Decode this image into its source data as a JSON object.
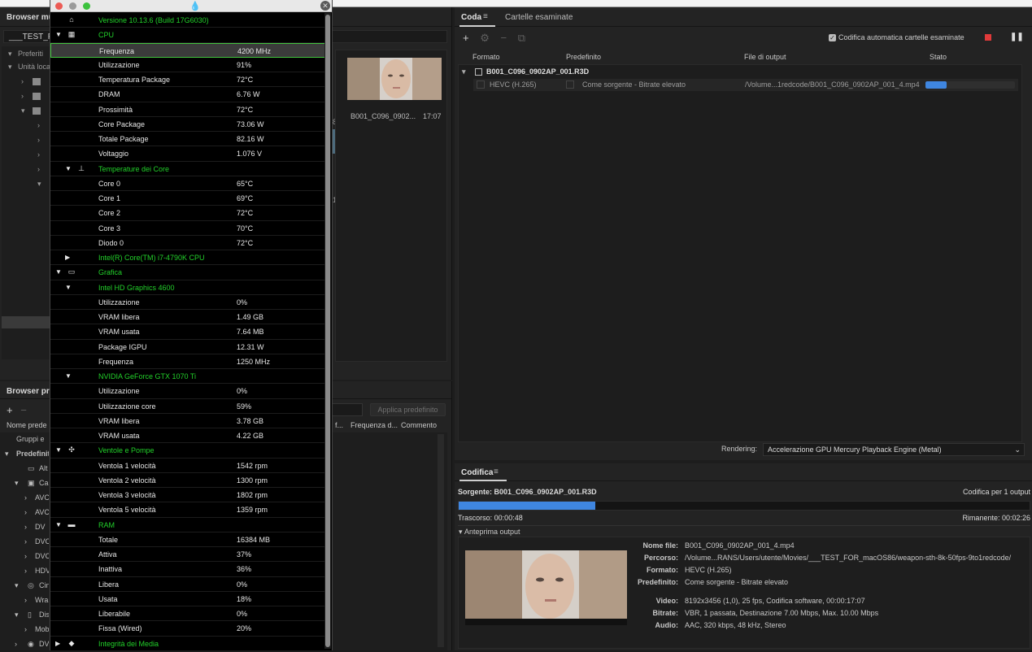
{
  "media_browser": {
    "title": "Browser mult",
    "path": "___TEST_FO",
    "tree": [
      "Preferiti",
      "Unità loca"
    ],
    "thumb": {
      "name": "B001_C096_0902...",
      "time": "17:07"
    },
    "frag_8": "8",
    "frag_1": "1"
  },
  "preset_browser": {
    "title": "Browser pred",
    "apply_label": "Applica predefinito",
    "cols": {
      "name": "Nome prede",
      "f": "f...",
      "freq": "Frequenza d...",
      "comment": "Commento"
    },
    "rows": [
      "Gruppi e",
      "Predefinit",
      "Alt",
      "Car",
      "AVC",
      "AVC",
      "DV",
      "DVC",
      "DVC",
      "HDV",
      "Cin",
      "Wra",
      "Dis",
      "Mob",
      "DV"
    ]
  },
  "queue": {
    "tab_queue": "Coda",
    "tab_watch": "Cartelle esaminate",
    "auto_encode_label": "Codifica automatica cartelle esaminate",
    "cols": {
      "format": "Formato",
      "preset": "Predefinito",
      "output": "File di output",
      "status": "Stato"
    },
    "source": "B001_C096_0902AP_001.R3D",
    "item": {
      "format": "HEVC (H.265)",
      "preset": "Come sorgente - Bitrate elevato",
      "output": "/Volume...1redcode/B001_C096_0902AP_001_4.mp4",
      "progress": 0.24
    },
    "rendering_label": "Rendering:",
    "rendering_value": "Accelerazione GPU Mercury Playback Engine (Metal)"
  },
  "encoding": {
    "title": "Codifica",
    "source": "Sorgente: B001_C096_0902AP_001.R3D",
    "count": "Codifica per 1 output",
    "progress": 0.24,
    "elapsed": "Trascorso: 00:00:48",
    "remaining": "Rimanente: 00:02:26",
    "preview_label": "Anteprima output",
    "details": [
      {
        "k": "Nome file:",
        "v": "B001_C096_0902AP_001_4.mp4"
      },
      {
        "k": "Percorso:",
        "v": "/Volume...RANS/Users/utente/Movies/___TEST_FOR_macOS86/weapon-sth-8k-50fps-9to1redcode/"
      },
      {
        "k": "Formato:",
        "v": "HEVC (H.265)"
      },
      {
        "k": "Predefinito:",
        "v": "Come sorgente - Bitrate elevato"
      },
      {
        "k": "Video:",
        "v": "8192x3456 (1,0), 25 fps, Codifica software, 00:00:17:07"
      },
      {
        "k": "Bitrate:",
        "v": "VBR, 1 passata, Destinazione 7.00 Mbps, Max. 10.00 Mbps"
      },
      {
        "k": "Audio:",
        "v": "AAC, 320 kbps, 48 kHz, Stereo"
      }
    ]
  },
  "hwmonitor": {
    "rows": [
      {
        "type": "hdr",
        "indent": 1,
        "icon": "computer-icon",
        "label": "Versione 10.13.6 (Build 17G6030)"
      },
      {
        "type": "hdr",
        "indent": 1,
        "tri": "▼",
        "icon": "cpu-icon",
        "label": "CPU"
      },
      {
        "type": "sel",
        "indent": 2,
        "label": "Frequenza",
        "value": "4200 MHz"
      },
      {
        "type": "item",
        "indent": 2,
        "label": "Utilizzazione",
        "value": "91%"
      },
      {
        "type": "item",
        "indent": 2,
        "label": "Temperatura Package",
        "value": "72°C"
      },
      {
        "type": "item",
        "indent": 2,
        "label": "DRAM",
        "value": "6.76 W"
      },
      {
        "type": "item",
        "indent": 2,
        "label": "Prossimità",
        "value": "72°C"
      },
      {
        "type": "item",
        "indent": 2,
        "label": "Core Package",
        "value": "73.06 W"
      },
      {
        "type": "item",
        "indent": 2,
        "label": "Totale Package",
        "value": "82.16 W"
      },
      {
        "type": "item",
        "indent": 2,
        "label": "Voltaggio",
        "value": "1.076 V"
      },
      {
        "type": "hdr",
        "indent": 2,
        "tri": "▼",
        "icon": "thermometer-icon",
        "label": "Temperature dei Core"
      },
      {
        "type": "item",
        "indent": 2,
        "label": "Core 0",
        "value": "65°C"
      },
      {
        "type": "item",
        "indent": 2,
        "label": "Core 1",
        "value": "69°C"
      },
      {
        "type": "item",
        "indent": 2,
        "label": "Core 2",
        "value": "72°C"
      },
      {
        "type": "item",
        "indent": 2,
        "label": "Core 3",
        "value": "70°C"
      },
      {
        "type": "item",
        "indent": 2,
        "label": "Diodo 0",
        "value": "72°C"
      },
      {
        "type": "hdr",
        "indent": 2,
        "tri": "▶",
        "label": "Intel(R) Core(TM) i7-4790K CPU"
      },
      {
        "type": "hdr",
        "indent": 1,
        "tri": "▼",
        "icon": "gpu-icon",
        "label": "Grafica"
      },
      {
        "type": "hdr",
        "indent": 2,
        "tri": "▼",
        "label": "Intel HD Graphics 4600"
      },
      {
        "type": "item",
        "indent": 2,
        "label": "Utilizzazione",
        "value": "0%"
      },
      {
        "type": "item",
        "indent": 2,
        "label": "VRAM libera",
        "value": "1.49 GB"
      },
      {
        "type": "item",
        "indent": 2,
        "label": "VRAM usata",
        "value": "7.64 MB"
      },
      {
        "type": "item",
        "indent": 2,
        "label": "Package IGPU",
        "value": "12.31 W"
      },
      {
        "type": "item",
        "indent": 2,
        "label": "Frequenza",
        "value": "1250 MHz"
      },
      {
        "type": "hdr",
        "indent": 2,
        "tri": "▼",
        "label": "NVIDIA GeForce GTX 1070 Ti"
      },
      {
        "type": "item",
        "indent": 2,
        "label": "Utilizzazione",
        "value": "0%"
      },
      {
        "type": "item",
        "indent": 2,
        "label": "Utilizzazione core",
        "value": "59%"
      },
      {
        "type": "item",
        "indent": 2,
        "label": "VRAM libera",
        "value": "3.78 GB"
      },
      {
        "type": "item",
        "indent": 2,
        "label": "VRAM usata",
        "value": "4.22 GB"
      },
      {
        "type": "hdr",
        "indent": 1,
        "tri": "▼",
        "icon": "fan-icon",
        "label": "Ventole e Pompe"
      },
      {
        "type": "item",
        "indent": 2,
        "label": "Ventola 1 velocità",
        "value": "1542 rpm"
      },
      {
        "type": "item",
        "indent": 2,
        "label": "Ventola 2 velocità",
        "value": "1300 rpm"
      },
      {
        "type": "item",
        "indent": 2,
        "label": "Ventola 3 velocità",
        "value": "1802 rpm"
      },
      {
        "type": "item",
        "indent": 2,
        "label": "Ventola 5 velocità",
        "value": "1359 rpm"
      },
      {
        "type": "hdr",
        "indent": 1,
        "tri": "▼",
        "icon": "ram-icon",
        "label": "RAM"
      },
      {
        "type": "item",
        "indent": 2,
        "label": "Totale",
        "value": "16384 MB"
      },
      {
        "type": "item",
        "indent": 2,
        "label": "Attiva",
        "value": "37%"
      },
      {
        "type": "item",
        "indent": 2,
        "label": "Inattiva",
        "value": "36%"
      },
      {
        "type": "item",
        "indent": 2,
        "label": "Libera",
        "value": "0%"
      },
      {
        "type": "item",
        "indent": 2,
        "label": "Usata",
        "value": "18%"
      },
      {
        "type": "item",
        "indent": 2,
        "label": "Liberabile",
        "value": "0%"
      },
      {
        "type": "item",
        "indent": 2,
        "label": "Fissa (Wired)",
        "value": "20%"
      },
      {
        "type": "hdr",
        "indent": 1,
        "tri": "▶",
        "icon": "disk-icon",
        "label": "Integrità dei Media"
      }
    ]
  }
}
